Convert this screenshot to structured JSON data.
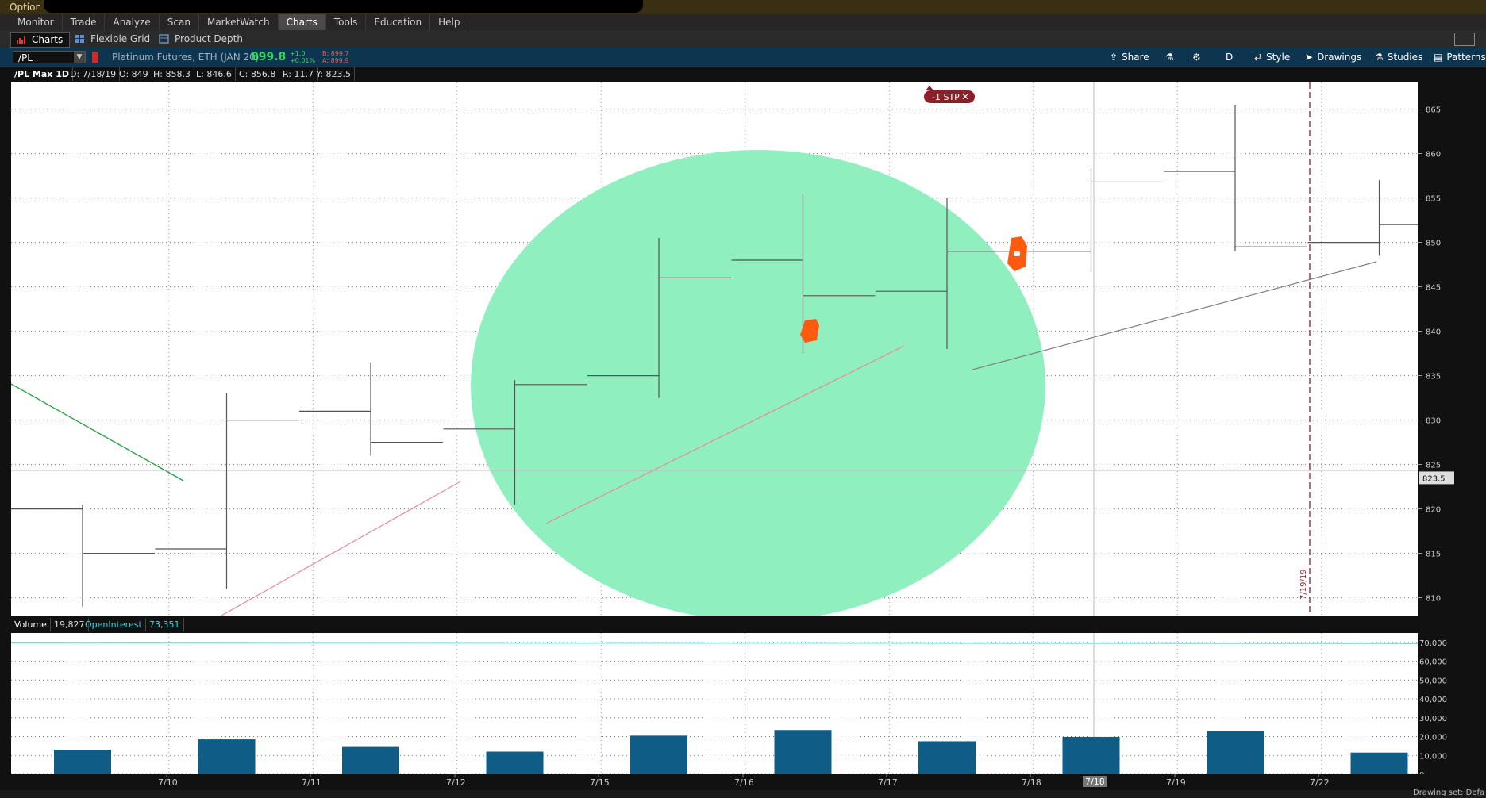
{
  "window": {
    "title": "Option l"
  },
  "menu": [
    "Monitor",
    "Trade",
    "Analyze",
    "Scan",
    "MarketWatch",
    "Charts",
    "Tools",
    "Education",
    "Help"
  ],
  "menu_active": "Charts",
  "subtabs": {
    "charts": "Charts",
    "flexible_grid": "Flexible Grid",
    "product_depth": "Product Depth"
  },
  "symbol": {
    "ticker": "/PL",
    "description": "Platinum Futures, ETH (JAN 20)",
    "last": "899.8",
    "change": "+1.0",
    "change_pct": "+0.01%",
    "bid": "B: 899.7",
    "ask": "A: 899.9"
  },
  "toolbar": {
    "share": "Share",
    "aggregation": "D",
    "style": "Style",
    "drawings": "Drawings",
    "studies": "Studies",
    "patterns": "Patterns"
  },
  "info": {
    "name": "/PL Max 1D",
    "date": "D: 7/18/19",
    "open": "O: 849",
    "high": "H: 858.3",
    "low": "L: 846.6",
    "close": "C: 856.8",
    "range": "R: 11.7",
    "y": "Y: 823.5"
  },
  "order_label": "-1 STP",
  "price_cursor": "823.5",
  "expiry_label": "7/19/19",
  "volume_bar": {
    "label": "Volume",
    "value": "19,827",
    "oi_label": "OpenInterest",
    "oi_value": "73,351"
  },
  "x_cursor_label": "7/18",
  "status": {
    "drawing_set": "Drawing set: Defa"
  },
  "colors": {
    "accent_blue": "#0e3550",
    "up_green": "#2fd75a",
    "highlight": "#90efbf",
    "volume_bar": "#0f5d86",
    "marker": "#ff5a10"
  },
  "chart_data": {
    "type": "bar",
    "price_axis": {
      "ticks": [
        865,
        860,
        855,
        850,
        845,
        840,
        835,
        830,
        825,
        820,
        815,
        810
      ],
      "range": [
        808,
        868
      ]
    },
    "volume_axis": {
      "ticks": [
        "70,000",
        "60,000",
        "50,000",
        "40,000",
        "30,000",
        "20,000",
        "10,000",
        "0"
      ],
      "range": [
        0,
        75000
      ]
    },
    "date_labels": [
      "7/10",
      "7/11",
      "7/12",
      "7/15",
      "7/16",
      "7/17",
      "7/18",
      "7/19",
      "7/22"
    ],
    "ohlc": [
      {
        "open": 820,
        "high": 820.5,
        "low": 809,
        "close": 815
      },
      {
        "open": 815.5,
        "high": 833,
        "low": 811,
        "close": 830
      },
      {
        "open": 831,
        "high": 836.5,
        "low": 826,
        "close": 827.5
      },
      {
        "open": 829,
        "high": 834.5,
        "low": 820.5,
        "close": 834
      },
      {
        "open": 835,
        "high": 850.5,
        "low": 832.5,
        "close": 846
      },
      {
        "open": 848,
        "high": 855.5,
        "low": 837.5,
        "close": 844
      },
      {
        "open": 844.5,
        "high": 855,
        "low": 838,
        "close": 849
      },
      {
        "open": 849,
        "high": 858.3,
        "low": 846.6,
        "close": 856.8
      },
      {
        "open": 858,
        "high": 865.5,
        "low": 849,
        "close": 849.5
      },
      {
        "open": 850,
        "high": 857,
        "low": 848.5,
        "close": 852
      }
    ],
    "volume": [
      13000,
      18500,
      14500,
      12000,
      20500,
      23500,
      17500,
      19827,
      23000,
      11500
    ],
    "open_interest": 73351
  }
}
